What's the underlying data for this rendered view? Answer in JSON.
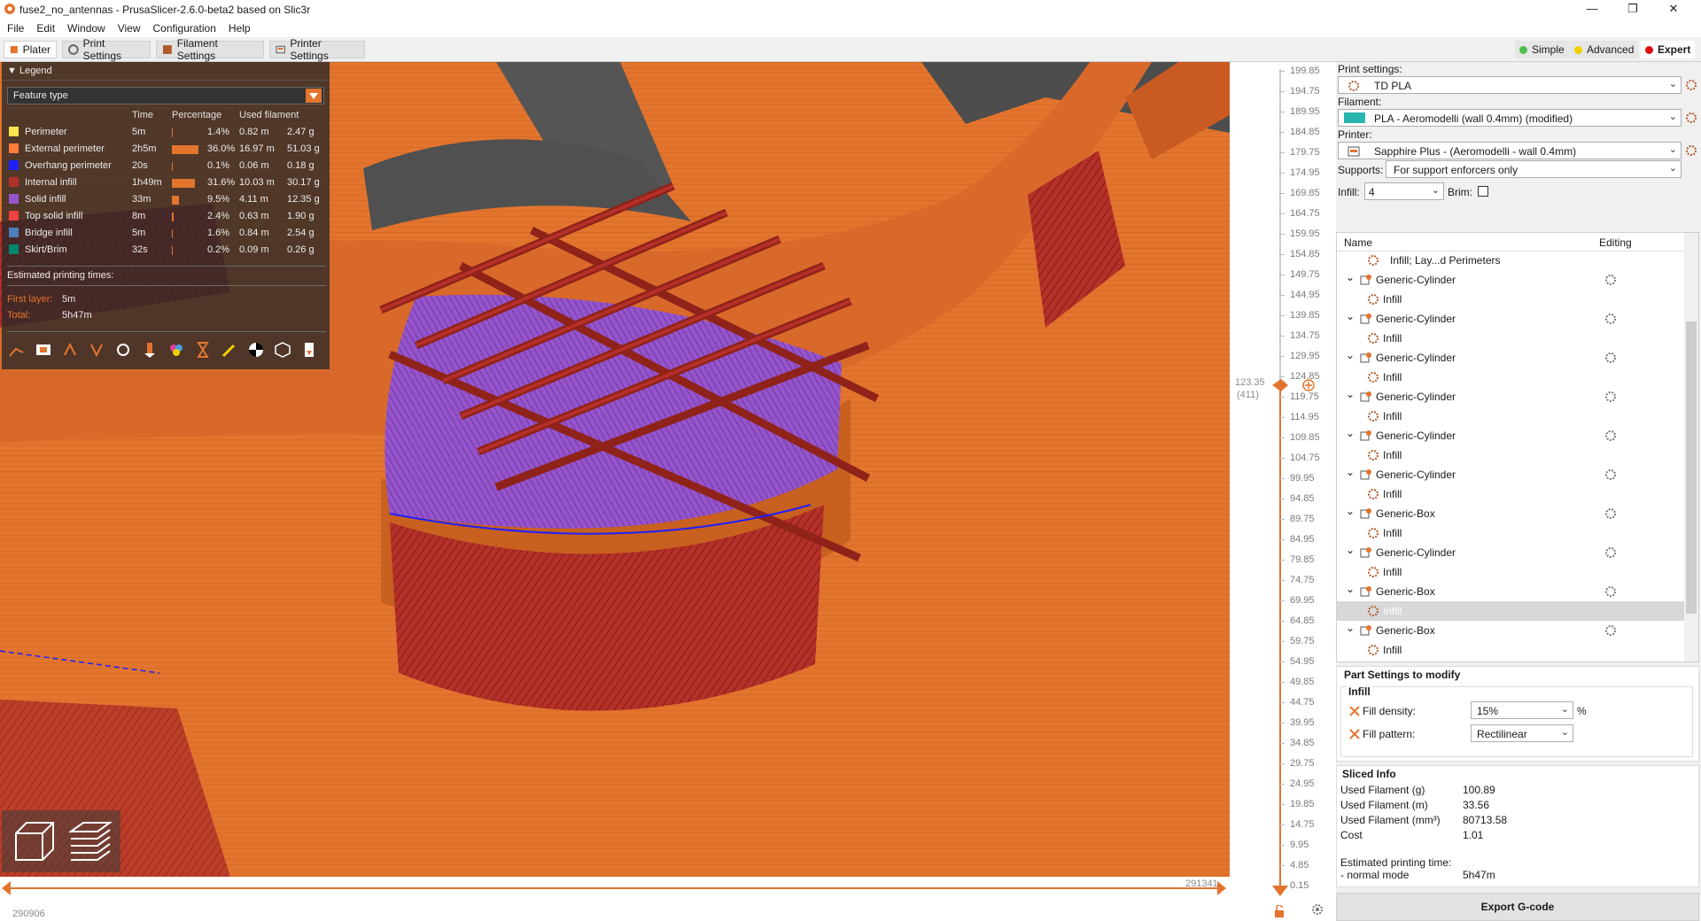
{
  "window": {
    "title": "fuse2_no_antennas - PrusaSlicer-2.6.0-beta2 based on Slic3r",
    "controls": [
      "—",
      "❐",
      "✕"
    ]
  },
  "menu": [
    "File",
    "Edit",
    "Window",
    "View",
    "Configuration",
    "Help"
  ],
  "tabs": [
    "Plater",
    "Print Settings",
    "Filament Settings",
    "Printer Settings"
  ],
  "modes": [
    {
      "label": "Simple",
      "color": "#4cc04c"
    },
    {
      "label": "Advanced",
      "color": "#f0d000"
    },
    {
      "label": "Expert",
      "color": "#e01010"
    }
  ],
  "legend": {
    "title": "Legend",
    "view_type": "Feature type",
    "columns": {
      "time": "Time",
      "percentage": "Percentage",
      "used": "Used filament"
    },
    "rows": [
      {
        "name": "Perimeter",
        "color": "#ffe64d",
        "time": "5m",
        "pct": "1.4%",
        "pct_value": 1.4,
        "meters": "0.82 m",
        "grams": "2.47 g"
      },
      {
        "name": "External perimeter",
        "color": "#ff7d38",
        "time": "2h5m",
        "pct": "36.0%",
        "pct_value": 36.0,
        "meters": "16.97 m",
        "grams": "51.03 g"
      },
      {
        "name": "Overhang perimeter",
        "color": "#1f1fff",
        "time": "20s",
        "pct": "0.1%",
        "pct_value": 0.1,
        "meters": "0.06 m",
        "grams": "0.18 g"
      },
      {
        "name": "Internal infill",
        "color": "#b03029",
        "time": "1h49m",
        "pct": "31.6%",
        "pct_value": 31.6,
        "meters": "10.03 m",
        "grams": "30.17 g"
      },
      {
        "name": "Solid infill",
        "color": "#9654cc",
        "time": "33m",
        "pct": "9.5%",
        "pct_value": 9.5,
        "meters": "4.11 m",
        "grams": "12.35 g"
      },
      {
        "name": "Top solid infill",
        "color": "#f04040",
        "time": "8m",
        "pct": "2.4%",
        "pct_value": 2.4,
        "meters": "0.63 m",
        "grams": "1.90 g"
      },
      {
        "name": "Bridge infill",
        "color": "#4d80ba",
        "time": "5m",
        "pct": "1.6%",
        "pct_value": 1.6,
        "meters": "0.84 m",
        "grams": "2.54 g"
      },
      {
        "name": "Skirt/Brim",
        "color": "#00876e",
        "time": "32s",
        "pct": "0.2%",
        "pct_value": 0.2,
        "meters": "0.09 m",
        "grams": "0.26 g"
      }
    ],
    "estimated_label": "Estimated printing times:",
    "first_layer_label": "First layer:",
    "first_layer_value": "5m",
    "total_label": "Total:",
    "total_value": "5h47m"
  },
  "layer_slider": {
    "ticks": [
      "199.85",
      "194.75",
      "189.95",
      "184.85",
      "179.75",
      "174.95",
      "169.85",
      "164.75",
      "159.95",
      "154.85",
      "149.75",
      "144.95",
      "139.85",
      "134.75",
      "129.95",
      "124.85",
      "119.75",
      "114.95",
      "109.85",
      "104.75",
      "99.95",
      "94.85",
      "89.75",
      "84.95",
      "79.85",
      "74.75",
      "69.95",
      "64.85",
      "59.75",
      "54.95",
      "49.85",
      "44.75",
      "39.95",
      "34.85",
      "29.75",
      "24.95",
      "19.85",
      "14.75",
      "9.95",
      "4.85",
      "0.15"
    ],
    "current_height": "123.35",
    "current_layer": "(411)"
  },
  "horizontal_slider": {
    "left_value": "290906",
    "right_value": "291341"
  },
  "sidebar": {
    "print_settings_label": "Print settings:",
    "print_settings_value": "TD PLA",
    "filament_label": "Filament:",
    "filament_value": "PLA - Aeromodelli (wall 0.4mm) (modified)",
    "filament_color": "#2ab5b0",
    "printer_label": "Printer:",
    "printer_value": "Sapphire Plus - (Aeromodelli - wall 0.4mm)",
    "supports_label": "Supports:",
    "supports_value": "For support enforcers only",
    "infill_label": "Infill:",
    "infill_value": "4",
    "brim_label": "Brim:"
  },
  "object_list": {
    "col_name": "Name",
    "col_editing": "Editing",
    "rows": [
      {
        "label": "Infill; Lay...d Perimeters",
        "kind": "settings",
        "selected": false
      },
      {
        "label": "Generic-Cylinder",
        "kind": "object",
        "selected": false
      },
      {
        "label": "Infill",
        "kind": "settings",
        "selected": false
      },
      {
        "label": "Generic-Cylinder",
        "kind": "object",
        "selected": false
      },
      {
        "label": "Infill",
        "kind": "settings",
        "selected": false
      },
      {
        "label": "Generic-Cylinder",
        "kind": "object",
        "selected": false
      },
      {
        "label": "Infill",
        "kind": "settings",
        "selected": false
      },
      {
        "label": "Generic-Cylinder",
        "kind": "object",
        "selected": false
      },
      {
        "label": "Infill",
        "kind": "settings",
        "selected": false
      },
      {
        "label": "Generic-Cylinder",
        "kind": "object",
        "selected": false
      },
      {
        "label": "Infill",
        "kind": "settings",
        "selected": false
      },
      {
        "label": "Generic-Cylinder",
        "kind": "object",
        "selected": false
      },
      {
        "label": "Infill",
        "kind": "settings",
        "selected": false
      },
      {
        "label": "Generic-Box",
        "kind": "object",
        "selected": false
      },
      {
        "label": "Infill",
        "kind": "settings",
        "selected": false
      },
      {
        "label": "Generic-Cylinder",
        "kind": "object",
        "selected": false
      },
      {
        "label": "Infill",
        "kind": "settings",
        "selected": false
      },
      {
        "label": "Generic-Box",
        "kind": "object",
        "selected": false
      },
      {
        "label": "Infill",
        "kind": "settings",
        "selected": true
      },
      {
        "label": "Generic-Box",
        "kind": "object",
        "selected": false
      },
      {
        "label": "Infill",
        "kind": "settings",
        "selected": false
      }
    ]
  },
  "part_settings": {
    "title": "Part Settings to modify",
    "group": "Infill",
    "fill_density_label": "Fill density:",
    "fill_density_value": "15%",
    "fill_density_unit": "%",
    "fill_pattern_label": "Fill pattern:",
    "fill_pattern_value": "Rectilinear"
  },
  "sliced_info": {
    "title": "Sliced Info",
    "rows": [
      {
        "label": "Used Filament (g)",
        "value": "100.89"
      },
      {
        "label": "Used Filament (m)",
        "value": "33.56"
      },
      {
        "label": "Used Filament (mm³)",
        "value": "80713.58"
      },
      {
        "label": "Cost",
        "value": "1.01"
      }
    ],
    "time_label": "Estimated printing time:",
    "mode_label": "- normal mode",
    "mode_value": "5h47m"
  },
  "export_button": "Export G-code",
  "colors": {
    "accent": "#e3742e",
    "bed": "#555555"
  }
}
